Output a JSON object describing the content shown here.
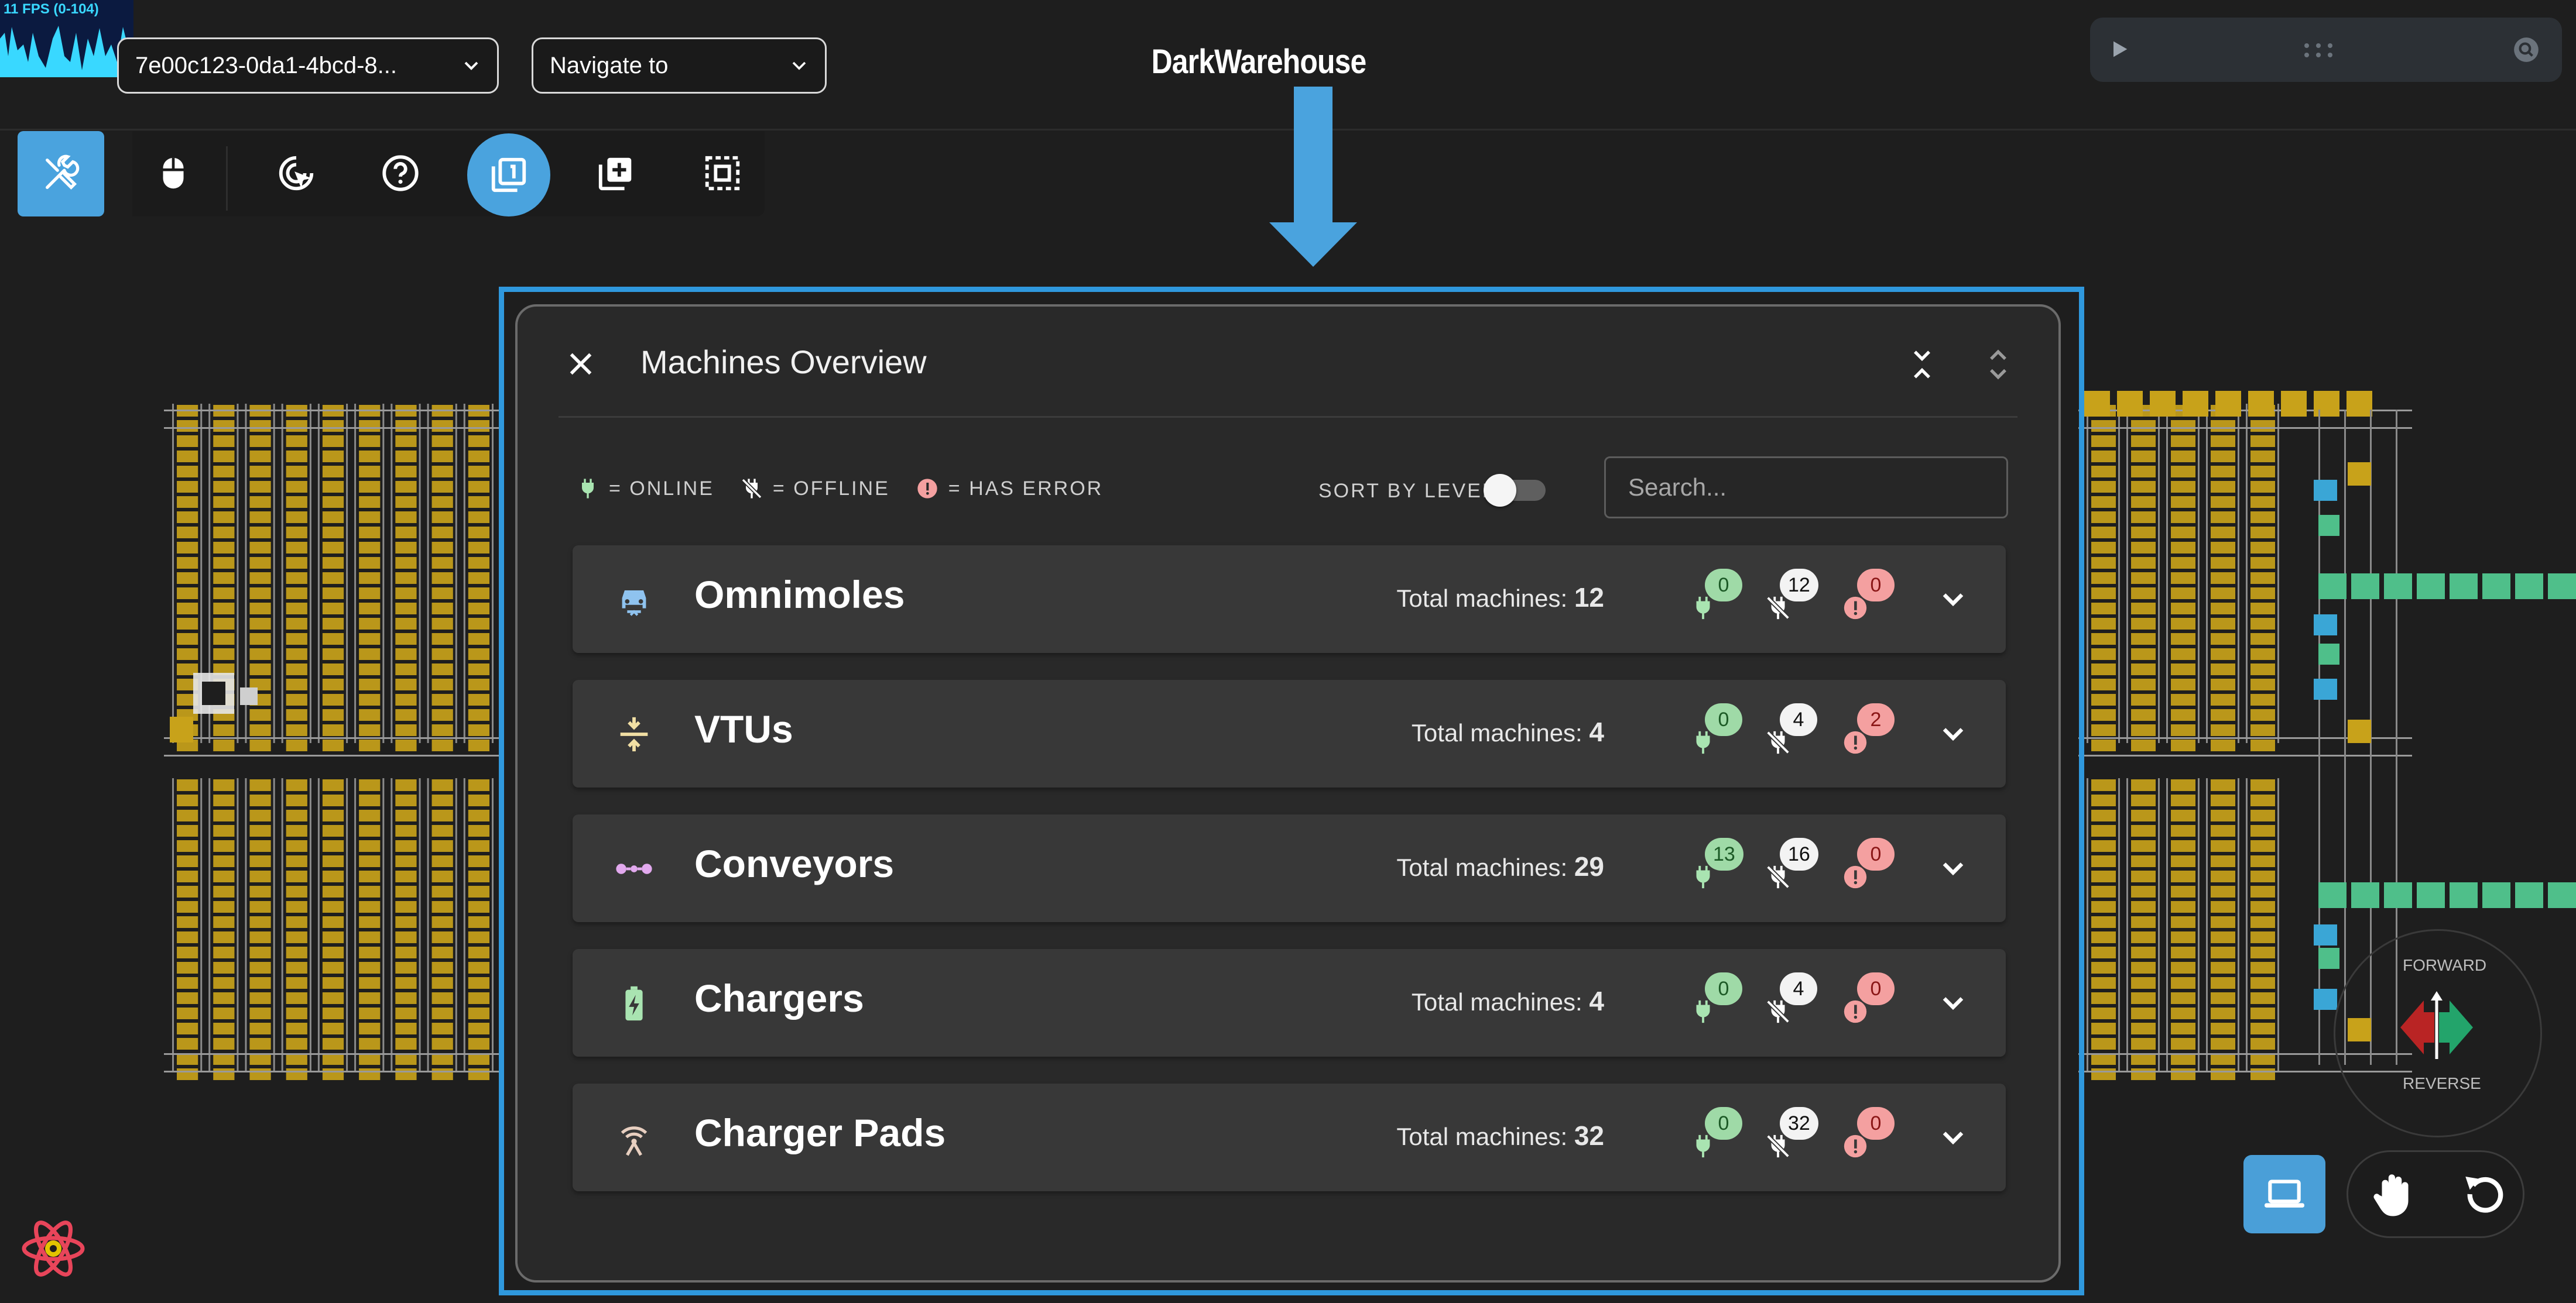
{
  "fps_label": "11 FPS (0-104)",
  "header": {
    "project_select": "7e00c123-0da1-4bcd-8...",
    "navigate_select": "Navigate to",
    "title": "DarkWarehouse"
  },
  "toolbar": {
    "tools": [
      "settings-icon",
      "mouse-icon",
      "cursor-click-icon",
      "help-icon",
      "layers-icon",
      "add-box-icon",
      "select-area-icon"
    ],
    "active": "layers-icon"
  },
  "modal": {
    "title": "Machines Overview",
    "legend": {
      "online": "= ONLINE",
      "offline": "= OFFLINE",
      "error": "= HAS ERROR"
    },
    "sort_label": "SORT BY LEVEL",
    "sort_by_level": false,
    "search_placeholder": "Search...",
    "total_label": "Total machines:",
    "groups": [
      {
        "name": "Omnimoles",
        "icon": "car-icon",
        "total": "12",
        "online": "0",
        "offline": "12",
        "errors": "0"
      },
      {
        "name": "VTUs",
        "icon": "vertical-align-center-icon",
        "total": "4",
        "online": "0",
        "offline": "4",
        "errors": "2"
      },
      {
        "name": "Conveyors",
        "icon": "conveyor-icon",
        "total": "29",
        "online": "13",
        "offline": "16",
        "errors": "0"
      },
      {
        "name": "Chargers",
        "icon": "battery-charging-icon",
        "total": "4",
        "online": "0",
        "offline": "4",
        "errors": "0"
      },
      {
        "name": "Charger Pads",
        "icon": "wireless-pad-icon",
        "total": "32",
        "online": "0",
        "offline": "32",
        "errors": "0"
      }
    ]
  },
  "drive_control": {
    "forward": "FORWARD",
    "reverse": "REVERSE"
  },
  "colors": {
    "accent": "#4aa3de",
    "frame": "#2f98dd",
    "online_green": "#9fdaa7",
    "error_red": "#f4a0a0",
    "rack_yellow": "#c8a21a"
  }
}
